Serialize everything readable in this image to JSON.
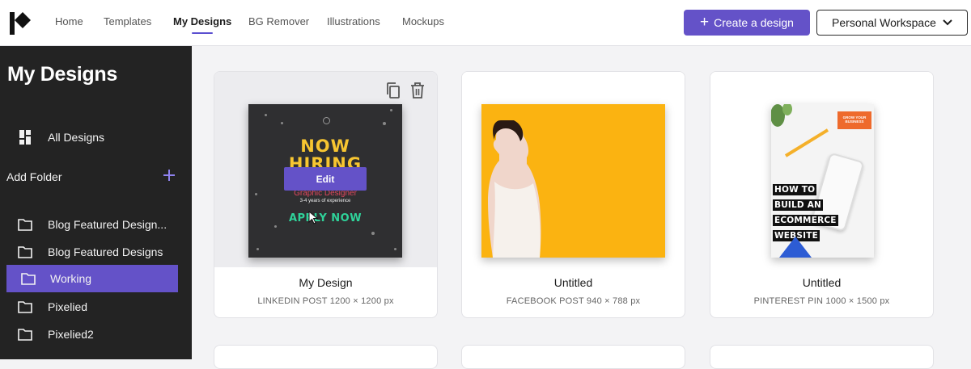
{
  "header": {
    "nav": [
      "Home",
      "Templates",
      "My Designs",
      "BG Remover",
      "Illustrations",
      "Mockups"
    ],
    "active_nav": "My Designs",
    "create_button": "Create a design",
    "workspace_button": "Personal Workspace"
  },
  "sidebar": {
    "title": "My Designs",
    "all_designs": "All Designs",
    "add_folder": "Add Folder",
    "folders": [
      {
        "label": "Blog Featured Design..."
      },
      {
        "label": "Blog Featured Designs"
      },
      {
        "label": "Working",
        "active": true
      },
      {
        "label": "Pixelied"
      },
      {
        "label": "Pixelied2"
      }
    ]
  },
  "designs": [
    {
      "name": "My Design",
      "size": "LINKEDIN POST 1200 × 1200 px",
      "edit_label": "Edit",
      "thumbnail": {
        "line1": "NOW",
        "line2": "HIRING",
        "role": "Graphic Designer",
        "experience": "3-4 years of experience",
        "cta": "APPLY NOW"
      }
    },
    {
      "name": "Untitled",
      "size": "FACEBOOK POST 940 × 788 px"
    },
    {
      "name": "Untitled",
      "size": "PINTEREST PIN 1000 × 1500 px",
      "thumbnail": {
        "lines": [
          "HOW TO",
          "BUILD AN",
          "ECOMMERCE",
          "WEBSITE"
        ],
        "badge": "GROW YOUR BUSINESS"
      }
    }
  ],
  "colors": {
    "accent": "#6452c8",
    "sidebar_bg": "#232323",
    "hiring_yellow": "#f7c531",
    "facebook_bg": "#fbb311"
  },
  "icons": {
    "logo": "pixelied-logo",
    "create_prefix": "plus-icon",
    "workspace_suffix": "chevron-down-icon",
    "all_designs": "grid-icon",
    "folder": "folder-icon",
    "add_folder": "plus-icon",
    "duplicate": "copy-icon",
    "delete": "trash-icon",
    "cursor": "mouse-pointer-icon"
  }
}
